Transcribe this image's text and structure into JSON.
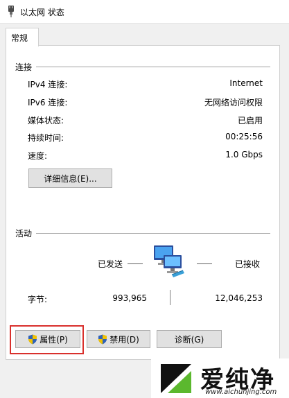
{
  "window": {
    "title": "以太网 状态",
    "icon": "ethernet-plug-icon"
  },
  "tabs": [
    {
      "label": "常规",
      "selected": true
    }
  ],
  "connection": {
    "group_title": "连接",
    "rows": [
      {
        "label": "IPv4 连接:",
        "value": "Internet"
      },
      {
        "label": "IPv6 连接:",
        "value": "无网络访问权限"
      },
      {
        "label": "媒体状态:",
        "value": "已启用"
      },
      {
        "label": "持续时间:",
        "value": "00:25:56"
      },
      {
        "label": "速度:",
        "value": "1.0 Gbps"
      }
    ],
    "details_button": "详细信息(E)..."
  },
  "activity": {
    "group_title": "活动",
    "sent_label": "已发送",
    "received_label": "已接收",
    "bytes_label": "字节:",
    "bytes_sent": "993,965",
    "bytes_received": "12,046,253",
    "icon": "network-computers-icon"
  },
  "buttons": {
    "properties": "属性(P)",
    "disable": "禁用(D)",
    "diagnose": "诊断(G)"
  },
  "watermark": {
    "text": "爱纯净",
    "url": "www.aichunjing.com"
  },
  "colors": {
    "highlight_border": "#d9302c",
    "button_face": "#e1e1e1",
    "button_border": "#adadad"
  }
}
